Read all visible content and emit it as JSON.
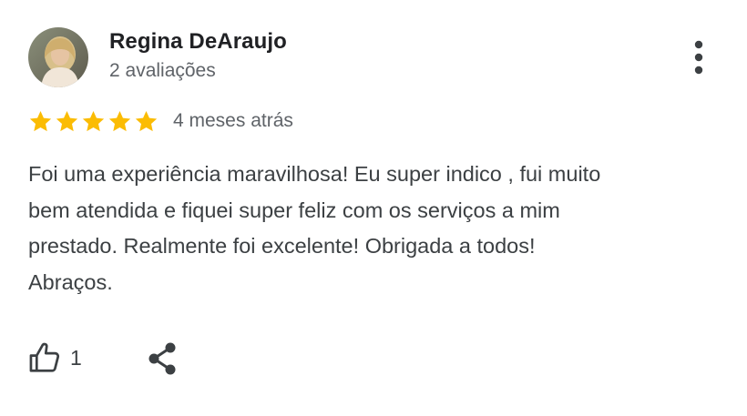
{
  "review": {
    "author": {
      "name": "Regina DeAraujo",
      "review_count": "2 avaliações",
      "avatar_icon": "user-photo"
    },
    "rating": {
      "stars": 5,
      "max_stars": 5,
      "star_color": "#fbbc04",
      "time_ago": "4 meses atrás"
    },
    "text_lines": [
      "Foi uma experiência maravilhosa! Eu super indico , fui muito",
      "bem atendida e fiquei super feliz com os serviços a mim",
      "prestado. Realmente foi excelente! Obrigada a todos!",
      "Abraços."
    ],
    "actions": {
      "like_icon": "thumbs-up-icon",
      "like_count": "1",
      "share_icon": "share-icon",
      "more_icon": "more-vertical-icon"
    }
  }
}
